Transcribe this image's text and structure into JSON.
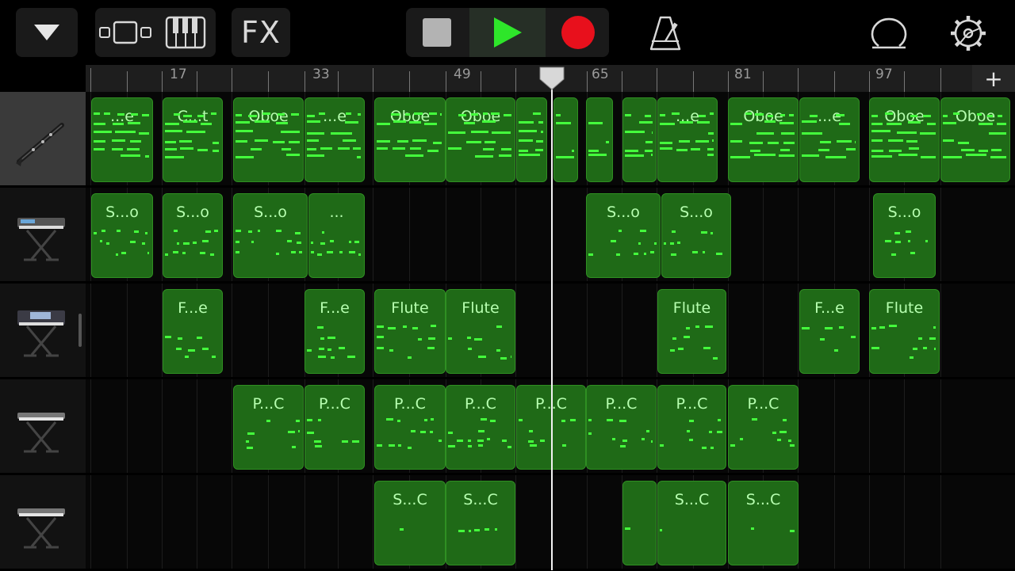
{
  "toolbar": {
    "fx_label": "FX",
    "record_color": "#e8101c",
    "play_color": "#2ee62a",
    "icons": [
      "dropdown-triangle-icon",
      "tracks-view-icon",
      "keyboard-icon",
      "stop-icon",
      "play-icon",
      "record-icon",
      "metronome-icon",
      "loop-icon",
      "settings-gear-icon"
    ]
  },
  "ruler": {
    "bar_numbers": [
      "17",
      "33",
      "49",
      "65",
      "81",
      "97"
    ],
    "add_label": "+"
  },
  "tracks": [
    {
      "instrument_icon": "clarinet-icon",
      "selected": true
    },
    {
      "instrument_icon": "synth-keyboard-stand-icon",
      "selected": false
    },
    {
      "instrument_icon": "workstation-keyboard-stand-icon",
      "selected": false
    },
    {
      "instrument_icon": "piano-keyboard-stand-icon",
      "selected": false
    },
    {
      "instrument_icon": "piano-keyboard-stand-icon",
      "selected": false
    }
  ],
  "regions": [
    [
      {
        "name": "...e"
      },
      {
        "name": "C...t"
      },
      {
        "name": "Oboe"
      },
      {
        "name": "...e"
      },
      {
        "name": "Oboe"
      },
      {
        "name": "Oboe"
      },
      {
        "name": ""
      },
      {
        "name": ""
      },
      {
        "name": ""
      },
      {
        "name": ""
      },
      {
        "name": "...e"
      },
      {
        "name": "Oboe"
      },
      {
        "name": "...e"
      },
      {
        "name": "Oboe"
      },
      {
        "name": "Oboe"
      }
    ],
    [
      {
        "name": "S...o"
      },
      {
        "name": "S...o"
      },
      {
        "name": "S...o"
      },
      {
        "name": "..."
      },
      {
        "name": "S...o"
      },
      {
        "name": "S...o"
      },
      {
        "name": "S...o"
      }
    ],
    [
      {
        "name": "F...e"
      },
      {
        "name": "F...e"
      },
      {
        "name": "Flute"
      },
      {
        "name": "Flute"
      },
      {
        "name": "Flute"
      },
      {
        "name": "F...e"
      },
      {
        "name": "Flute"
      }
    ],
    [
      {
        "name": "P...C"
      },
      {
        "name": "P...C"
      },
      {
        "name": "P...C"
      },
      {
        "name": "P...C"
      },
      {
        "name": "P...C"
      },
      {
        "name": "P...C"
      },
      {
        "name": "P...C"
      },
      {
        "name": "P...C"
      }
    ],
    [
      {
        "name": "S...C"
      },
      {
        "name": "S...C"
      },
      {
        "name": ""
      },
      {
        "name": "S...C"
      },
      {
        "name": "S...C"
      }
    ]
  ]
}
